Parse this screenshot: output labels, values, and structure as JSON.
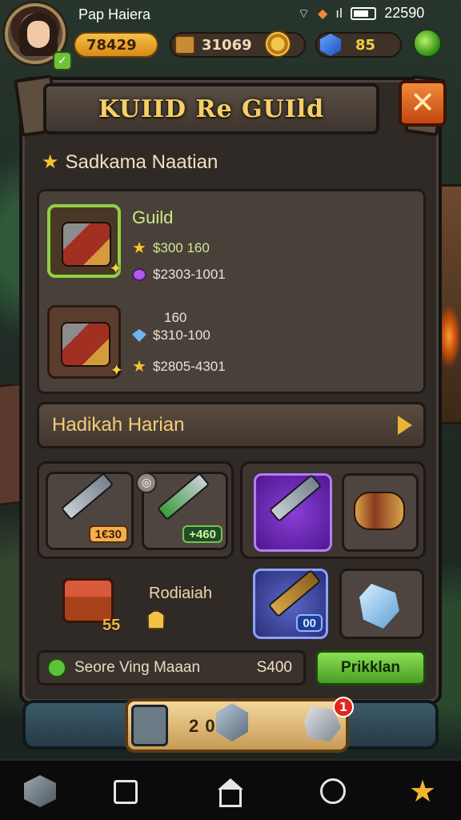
{
  "status_bar": {
    "player_name": "Pap Haiera",
    "clock": "22590",
    "signal": "ıl"
  },
  "resources": {
    "gold": "78429",
    "chests": "31069",
    "gems": "85"
  },
  "panel": {
    "title": "KUIID Re GUIld",
    "close_label": "✕",
    "section_title": "Sadkama Naatian",
    "section_star": "★"
  },
  "reward_list": {
    "item1_name": "Guild",
    "item1_stat1": "$300  160",
    "item1_stat2": "$2303-1001",
    "item2_stat0": "160",
    "item2_stat1": "$310-100",
    "item2_stat2": "$2805-4301",
    "spark": "✦"
  },
  "banner": {
    "label": "Hadikah Harian"
  },
  "grid": {
    "tag1": "1€30",
    "tag2": "+460",
    "tag3": "00",
    "lock": "◎",
    "chest_count": "55",
    "reward_label": "Rodiaiah"
  },
  "purchase": {
    "label": "Seore Ving Maaan",
    "price": "S400",
    "button_label": "Prikklan"
  },
  "currency_bar": {
    "value": "2   009",
    "notification_count": "1"
  },
  "colors": {
    "accent_gold": "#f5cf68",
    "accent_green": "#8be054",
    "close_orange": "#e36a24"
  }
}
